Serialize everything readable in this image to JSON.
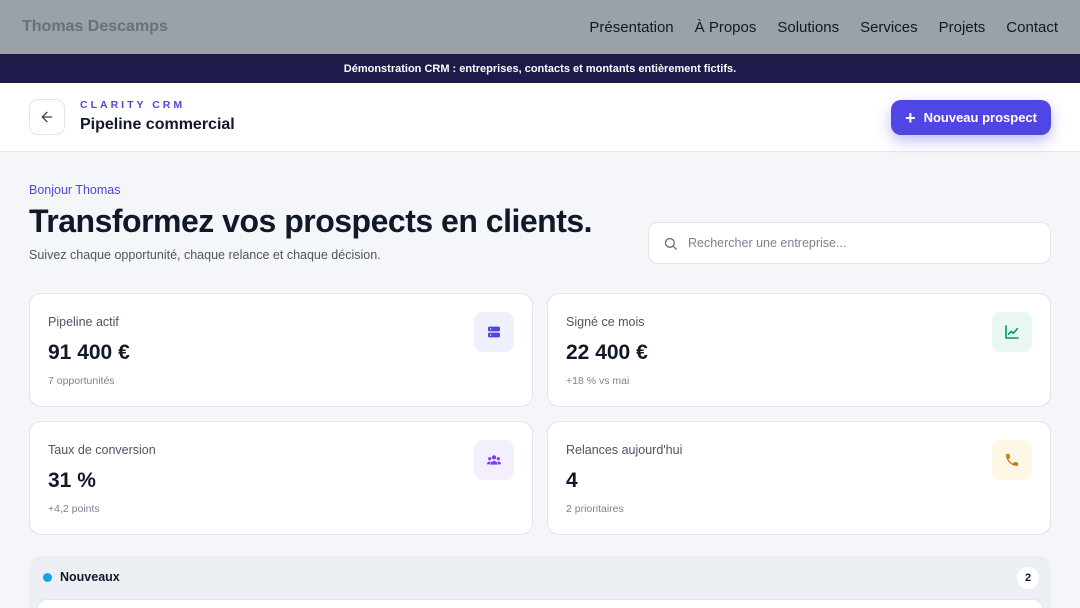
{
  "site": {
    "brand": "Thomas Descamps",
    "nav": [
      "Présentation",
      "À Propos",
      "Solutions",
      "Services",
      "Projets",
      "Contact"
    ]
  },
  "banner": "Démonstration CRM : entreprises, contacts et montants entièrement fictifs.",
  "header": {
    "kicker": "CLARITY CRM",
    "title": "Pipeline commercial",
    "new_button": "Nouveau prospect",
    "back_icon": "arrow-left-icon"
  },
  "hero": {
    "greeting": "Bonjour Thomas",
    "title": "Transformez vos prospects en clients.",
    "subtitle": "Suivez chaque opportunité, chaque relance et chaque décision."
  },
  "search": {
    "placeholder": "Rechercher une entreprise...",
    "value": ""
  },
  "stats": [
    {
      "label": "Pipeline actif",
      "value": "91 400 €",
      "note": "7 opportunités",
      "icon": "server-icon",
      "icon_color": "#4f46e5",
      "icon_bg": "#eef0fd"
    },
    {
      "label": "Signé ce mois",
      "value": "22 400 €",
      "note": "+18 % vs mai",
      "icon": "chart-line-icon",
      "icon_color": "#059669",
      "icon_bg": "#e8f8f1"
    },
    {
      "label": "Taux de conversion",
      "value": "31 %",
      "note": "+4,2 points",
      "icon": "users-icon",
      "icon_color": "#7c3aed",
      "icon_bg": "#f3efff"
    },
    {
      "label": "Relances aujourd'hui",
      "value": "4",
      "note": "2 prioritaires",
      "icon": "phone-icon",
      "icon_color": "#d97706",
      "icon_bg": "#fef7e6"
    }
  ],
  "column": {
    "title": "Nouveaux",
    "count": "2",
    "dot_color": "#0ea5e9"
  },
  "colors": {
    "accent": "#4f46e5",
    "banner_bg": "#1e1b4b",
    "nav_bg": "#9ba1a8"
  }
}
